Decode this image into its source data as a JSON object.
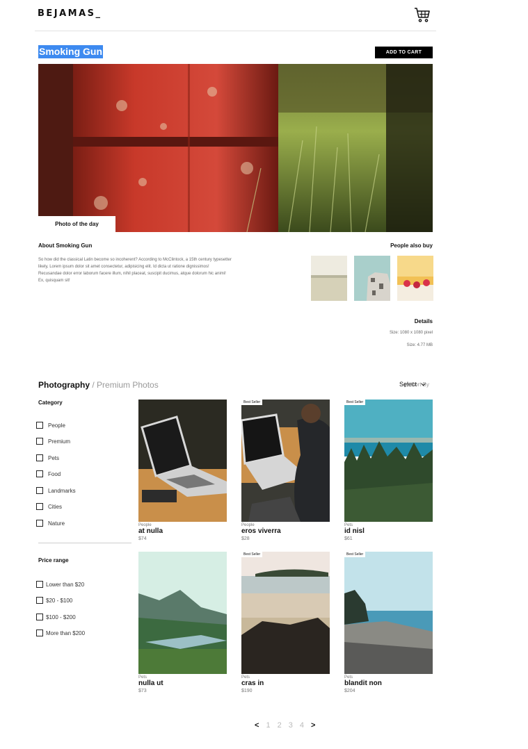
{
  "header": {
    "logo": "BEJAMAS_"
  },
  "featured": {
    "title": "Smoking Gun",
    "add_to_cart": "ADD TO CART",
    "badge": "Photo of the day",
    "about_title": "About Smoking Gun",
    "about_text": "So how did the classical Latin become so incoherent? According to McClintock, a 15th century typesetter likely, Lorem ipsum dolor sit amet consectetur, adipisicing elit. Id dicta ut ratione dignissimos! Recusandae dolor error laborum facere illum, nihil placeat, suscipit ducimus, atque dolorum hic animi! Ex, quisquam sit!",
    "also_buy_title": "People also buy",
    "details_title": "Details",
    "size": "Size: 1080 x 1080 pixel",
    "file_size": "Size: 4.77 MB"
  },
  "listing": {
    "breadcrumb_main": "Photography",
    "breadcrumb_sep": "/",
    "breadcrumb_sub": "Premium Photos",
    "sort_label": "Sort By",
    "sort_value": "Select"
  },
  "filters": {
    "category_title": "Category",
    "categories": [
      "People",
      "Premium",
      "Pets",
      "Food",
      "Landmarks",
      "Cities",
      "Nature"
    ],
    "price_title": "Price range",
    "prices": [
      "Lower than $20",
      "$20 - $100",
      "$100 - $200",
      "More than $200"
    ]
  },
  "products": [
    {
      "category": "People",
      "name": "at nulla",
      "price": "$74",
      "badge": ""
    },
    {
      "category": "People",
      "name": "eros viverra",
      "price": "$28",
      "badge": "Best Seller"
    },
    {
      "category": "Pets",
      "name": "id nisl",
      "price": "$61",
      "badge": "Best Seller"
    },
    {
      "category": "Pets",
      "name": "nulla ut",
      "price": "$73",
      "badge": ""
    },
    {
      "category": "Pets",
      "name": "cras in",
      "price": "$190",
      "badge": "Best Seller"
    },
    {
      "category": "Pets",
      "name": "blandit non",
      "price": "$204",
      "badge": "Best Seller"
    }
  ],
  "pagination": {
    "prev": "<",
    "pages": [
      "1",
      "2",
      "3",
      "4"
    ],
    "next": ">"
  }
}
